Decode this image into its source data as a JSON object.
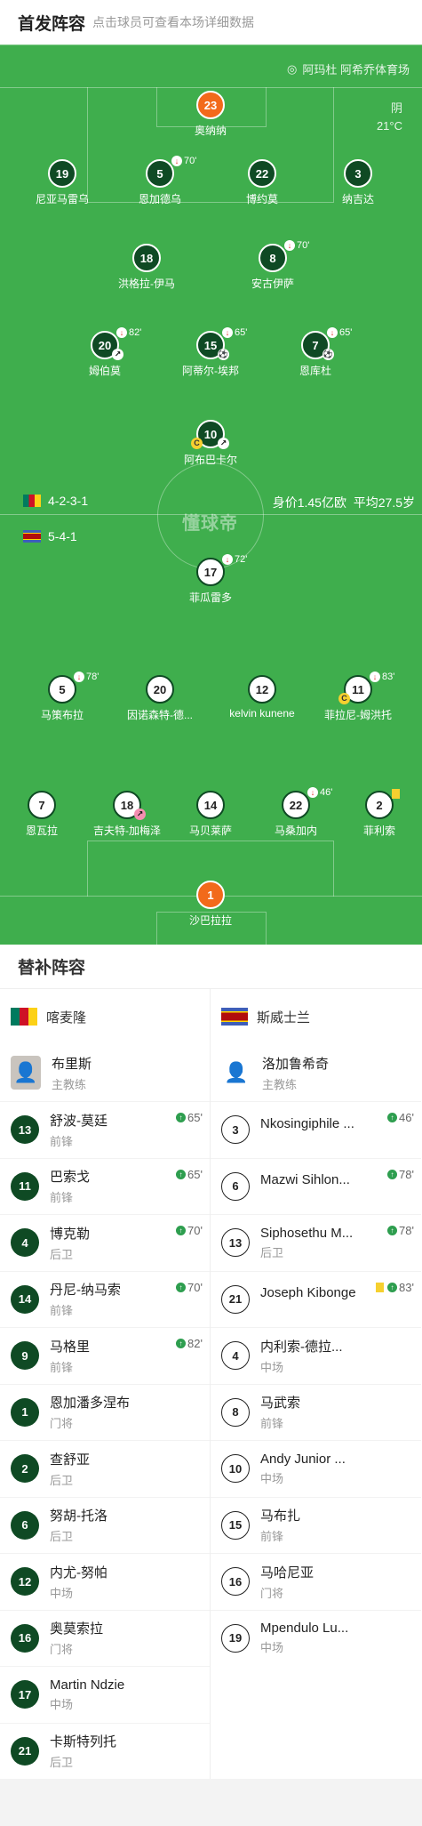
{
  "header": {
    "title": "首发阵容",
    "subtitle": "点击球员可查看本场详细数据"
  },
  "pitch": {
    "venue": "阿玛杜 阿希乔体育场",
    "weather": "阴",
    "temperature": "21°C",
    "watermark": "懂球帝",
    "home_formation": "4-2-3-1",
    "away_formation": "5-4-1",
    "value": "身价1.45亿欧",
    "age": "平均27.5岁"
  },
  "home_players": [
    {
      "num": "23",
      "name": "奥纳纳",
      "style": "o"
    },
    {
      "num": "19",
      "name": "尼亚马雷乌",
      "style": "d"
    },
    {
      "num": "5",
      "name": "恩加德乌",
      "style": "d",
      "sub": "70'"
    },
    {
      "num": "22",
      "name": "博约莫",
      "style": "d"
    },
    {
      "num": "3",
      "name": "纳吉达",
      "style": "d"
    },
    {
      "num": "18",
      "name": "洪格拉-伊马",
      "style": "d"
    },
    {
      "num": "8",
      "name": "安古伊萨",
      "style": "d",
      "sub": "70'"
    },
    {
      "num": "20",
      "name": "姆伯莫",
      "style": "d",
      "sub": "82'",
      "assist": true
    },
    {
      "num": "15",
      "name": "阿蒂尔-埃邦",
      "style": "d",
      "sub": "65'",
      "goal": true
    },
    {
      "num": "7",
      "name": "恩库杜",
      "style": "d",
      "sub": "65'",
      "goal": true
    },
    {
      "num": "10",
      "name": "阿布巴卡尔",
      "style": "d",
      "captain": true,
      "assist": true
    }
  ],
  "away_players": [
    {
      "num": "17",
      "name": "菲瓜雷多",
      "style": "w",
      "sub": "72'"
    },
    {
      "num": "5",
      "name": "马策布拉",
      "style": "w",
      "sub": "78'"
    },
    {
      "num": "20",
      "name": "因诺森特-德...",
      "style": "w"
    },
    {
      "num": "12",
      "name": "kelvin kunene",
      "style": "w"
    },
    {
      "num": "11",
      "name": "菲拉尼-姆洪托",
      "style": "w",
      "sub": "83'",
      "captain": true
    },
    {
      "num": "7",
      "name": "恩瓦拉",
      "style": "w"
    },
    {
      "num": "18",
      "name": "吉夫特-加梅泽",
      "style": "w",
      "own": true
    },
    {
      "num": "14",
      "name": "马贝莱萨",
      "style": "w"
    },
    {
      "num": "22",
      "name": "马桑加内",
      "style": "w",
      "sub": "46'"
    },
    {
      "num": "2",
      "name": "菲利索",
      "style": "w",
      "yellow": true
    },
    {
      "num": "1",
      "name": "沙巴拉拉",
      "style": "o"
    }
  ],
  "subs": {
    "title": "替补阵容",
    "home": {
      "team": "喀麦隆",
      "coach_name": "布里斯",
      "coach_role": "主教练",
      "players": [
        {
          "num": "13",
          "name": "舒波-莫廷",
          "pos": "前锋",
          "min": "65'"
        },
        {
          "num": "11",
          "name": "巴索戈",
          "pos": "前锋",
          "min": "65'"
        },
        {
          "num": "4",
          "name": "博克勒",
          "pos": "后卫",
          "min": "70'"
        },
        {
          "num": "14",
          "name": "丹尼-纳马索",
          "pos": "前锋",
          "min": "70'"
        },
        {
          "num": "9",
          "name": "马格里",
          "pos": "前锋",
          "min": "82'"
        },
        {
          "num": "1",
          "name": "恩加潘多涅布",
          "pos": "门将"
        },
        {
          "num": "2",
          "name": "查舒亚",
          "pos": "后卫"
        },
        {
          "num": "6",
          "name": "努胡-托洛",
          "pos": "后卫"
        },
        {
          "num": "12",
          "name": "内尤-努帕",
          "pos": "中场"
        },
        {
          "num": "16",
          "name": "奥莫索拉",
          "pos": "门将"
        },
        {
          "num": "17",
          "name": "Martin Ndzie",
          "pos": "中场"
        },
        {
          "num": "21",
          "name": "卡斯特列托",
          "pos": "后卫"
        }
      ]
    },
    "away": {
      "team": "斯威士兰",
      "coach_name": "洛加鲁希奇",
      "coach_role": "主教练",
      "players": [
        {
          "num": "3",
          "name": "Nkosingiphile ...",
          "pos": "",
          "min": "46'"
        },
        {
          "num": "6",
          "name": "Mazwi Sihlon...",
          "pos": "",
          "min": "78'"
        },
        {
          "num": "13",
          "name": "Siphosethu M...",
          "pos": "后卫",
          "min": "78'"
        },
        {
          "num": "21",
          "name": "Joseph Kibonge",
          "pos": "",
          "min": "83'",
          "yellow": true
        },
        {
          "num": "4",
          "name": "内利索-德拉...",
          "pos": "中场"
        },
        {
          "num": "8",
          "name": "马武索",
          "pos": "前锋"
        },
        {
          "num": "10",
          "name": "Andy Junior ...",
          "pos": "中场"
        },
        {
          "num": "15",
          "name": "马布扎",
          "pos": "前锋"
        },
        {
          "num": "16",
          "name": "马哈尼亚",
          "pos": "门将"
        },
        {
          "num": "19",
          "name": "Mpendulo Lu...",
          "pos": "中场"
        }
      ]
    }
  }
}
